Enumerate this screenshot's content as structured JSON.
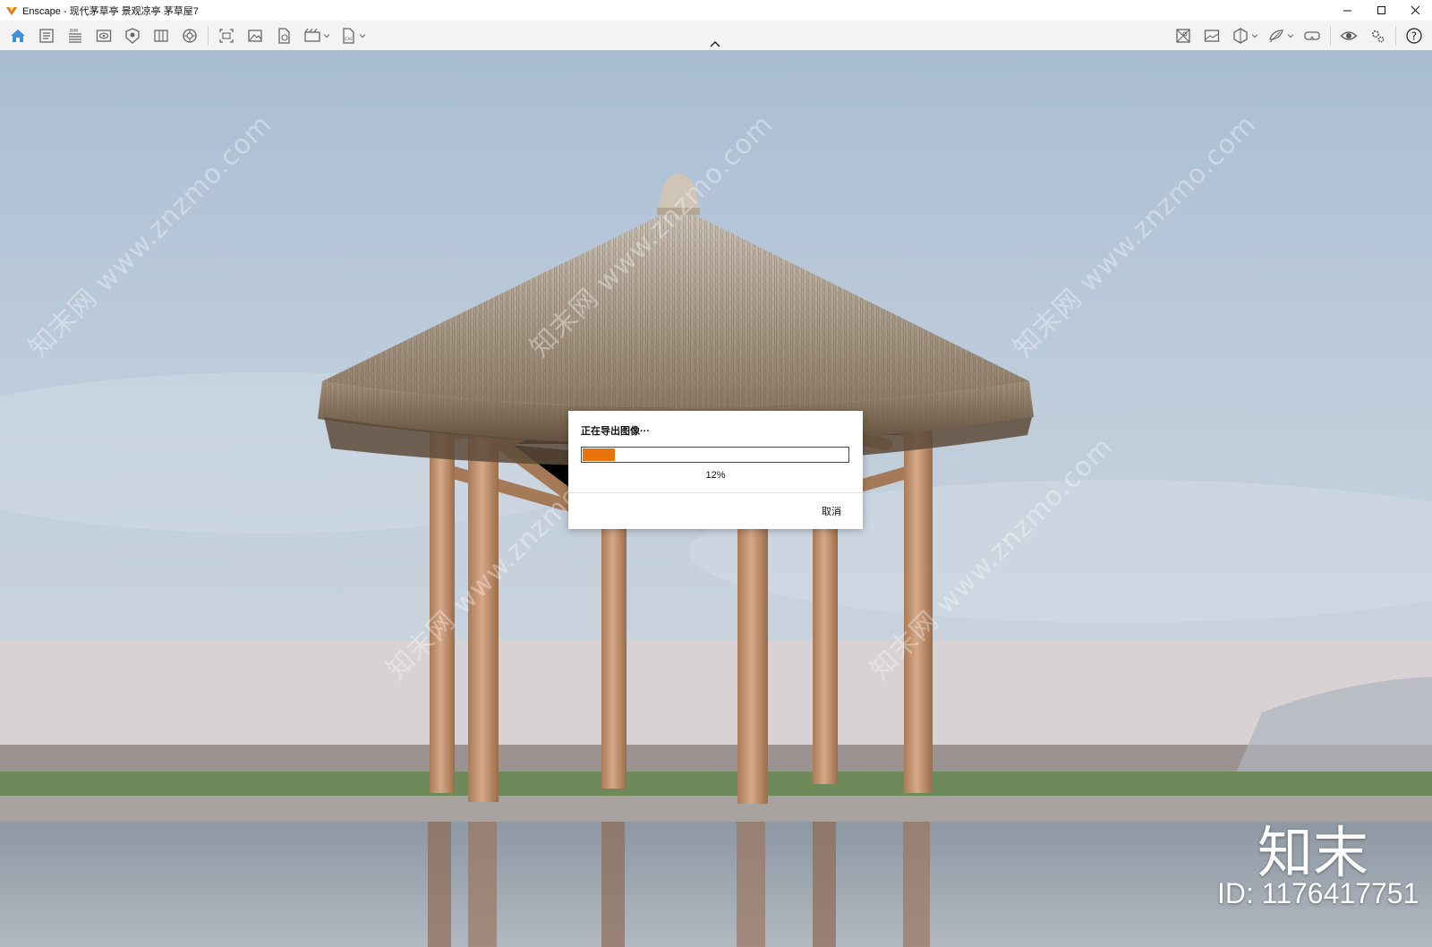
{
  "window": {
    "title": "Enscape - 现代茅草亭 景观凉亭 茅草屋7",
    "app_icon": "enscape-logo-icon",
    "controls": [
      "minimize-icon",
      "maximize-icon",
      "close-icon"
    ]
  },
  "toolbar": {
    "left_tools": [
      {
        "name": "home-icon"
      },
      {
        "name": "render-panel-icon"
      },
      {
        "name": "bim-icon"
      },
      {
        "name": "views-icon"
      },
      {
        "name": "asset-library-icon"
      },
      {
        "name": "material-editor-icon"
      },
      {
        "name": "atmosphere-settings-icon"
      },
      {
        "name": "screenshot-icon"
      },
      {
        "name": "batch-render-icon"
      },
      {
        "name": "export-file-icon"
      },
      {
        "name": "video-editor-icon",
        "dropdown": true
      },
      {
        "name": "export-exe-icon",
        "dropdown": true
      }
    ],
    "right_tools": [
      {
        "name": "map-view-icon"
      },
      {
        "name": "image-view-icon"
      },
      {
        "name": "section-icon",
        "dropdown": true
      },
      {
        "name": "render-quality-icon",
        "dropdown": true
      },
      {
        "name": "vr-headset-icon"
      },
      {
        "name": "visibility-icon"
      },
      {
        "name": "settings-icon"
      },
      {
        "name": "help-icon"
      }
    ]
  },
  "dialog": {
    "title": "正在导出图像···",
    "progress": 0.12,
    "progress_label": "12%",
    "cancel_label": "取消"
  },
  "overlay": {
    "watermark": "知末网 www.znzmo.com",
    "brand": "知末",
    "brand_id": "ID: 1176417751"
  },
  "colors": {
    "accent": "#e8730c",
    "sky": "#b7c8d8",
    "wall": "#d8d2d4",
    "water": "#9ea6ae"
  }
}
